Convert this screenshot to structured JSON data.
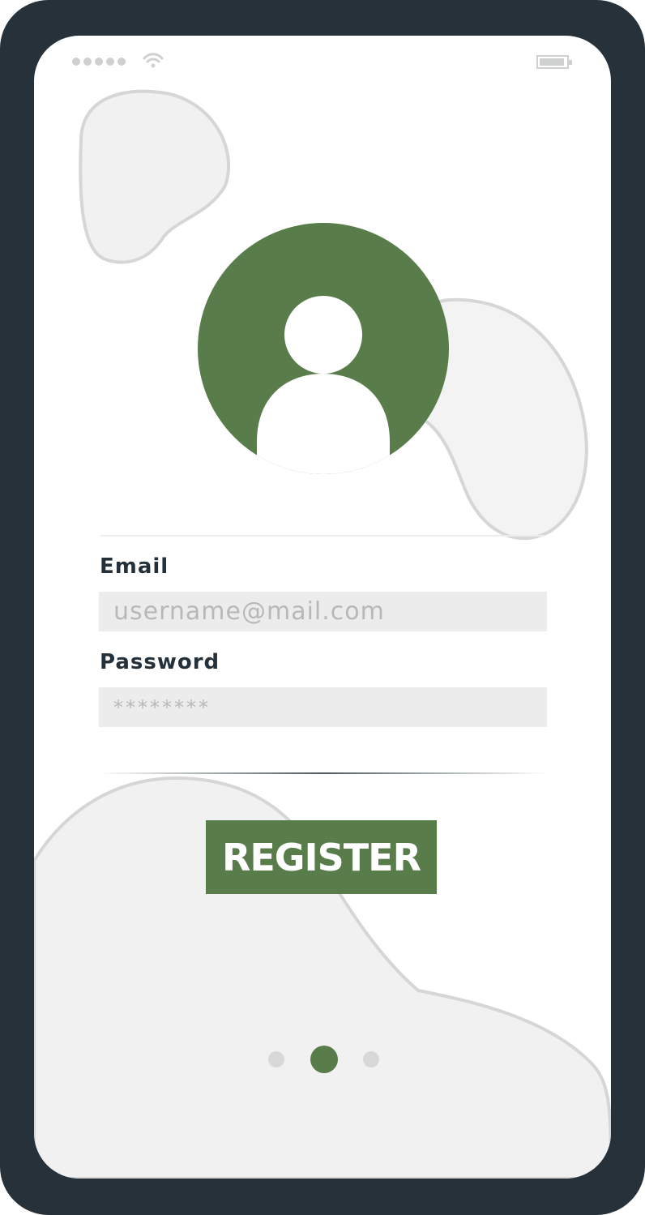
{
  "form": {
    "email_label": "Email",
    "email_placeholder": "username@mail.com",
    "password_label": "Password",
    "password_placeholder": "********"
  },
  "actions": {
    "register_label": "REGISTER"
  },
  "pagination": {
    "current_page": 2,
    "total_pages": 3
  },
  "colors": {
    "accent_green": "#597c4b",
    "frame": "#26313a",
    "input_bg": "#ececec",
    "shape_fill": "#f0f1f0",
    "shape_stroke": "#d6d6d6"
  },
  "icons": {
    "avatar": "user-avatar-icon",
    "wifi": "wifi-icon",
    "battery": "battery-icon"
  }
}
